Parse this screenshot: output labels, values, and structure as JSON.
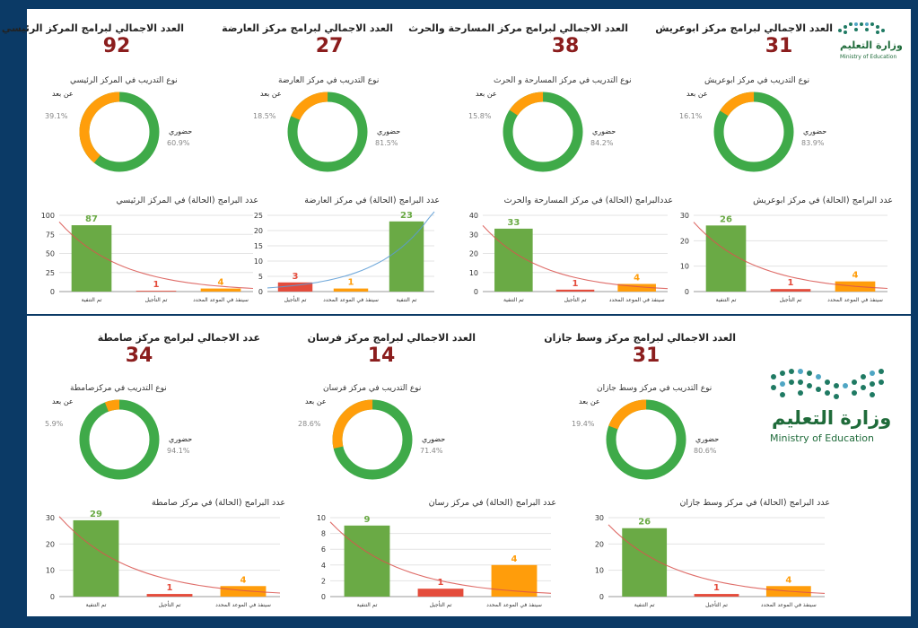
{
  "logo": {
    "arabic": "وزارة التعليم",
    "english": "Ministry of Education"
  },
  "labels": {
    "remote": "عن بعد",
    "inperson": "حضوري"
  },
  "centers": [
    {
      "title": "العدد الاجمالي لبرامج المركز الرئيسي",
      "total": "92",
      "donut_title": "نوع التدريب في المركز الرئيسي",
      "remote_pct": "39.1%",
      "inperson_pct": "60.9%",
      "bar_title": "عدد البرامج (الحالة) في المركز الرئيسي"
    },
    {
      "title": "العدد الاجمالي لبرامج مركز العارضة",
      "total": "27",
      "donut_title": "نوع التدريب في مركز العارضة",
      "remote_pct": "18.5%",
      "inperson_pct": "81.5%",
      "bar_title": "عدد البرامج (الحالة) في مركز العارضة"
    },
    {
      "title": "العدد الاجمالي لبرامج مركز المسارحة والحرث",
      "total": "38",
      "donut_title": "نوع التدريب في مركز المسارحة و الحرث",
      "remote_pct": "15.8%",
      "inperson_pct": "84.2%",
      "bar_title": "عددالبرامج (الحالة) في مركز المسارحة والحرث"
    },
    {
      "title": "العدد الاجمالي لبرامج مركز ابوعريش",
      "total": "31",
      "donut_title": "نوع التدريب في مركز ابوعريش",
      "remote_pct": "16.1%",
      "inperson_pct": "83.9%",
      "bar_title": "عدد البرامج (الحالة) في مركز ابوعريش"
    },
    {
      "title": "عدد الاجمالي لبرامج مركز صامطة",
      "total": "34",
      "donut_title": "نوع التدريب في مركزصامطة",
      "remote_pct": "5.9%",
      "inperson_pct": "94.1%",
      "bar_title": "عدد البرامج (الحالة) في مركز صامطة"
    },
    {
      "title": "العدد الاجمالي لبرامج مركز فرسان",
      "total": "14",
      "donut_title": "نوع التدريب في مركز فرسان",
      "remote_pct": "28.6%",
      "inperson_pct": "71.4%",
      "bar_title": "عدد البرامج (الحالة) في مركز رسان"
    },
    {
      "title": "العدد الاجمالي لبرامج مركز وسط جازان",
      "total": "31",
      "donut_title": "نوع التدريب في مركز وسط جازان",
      "remote_pct": "19.4%",
      "inperson_pct": "80.6%",
      "bar_title": "عدد البرامج (الحالة) في مركز وسط جازان"
    }
  ],
  "chart_data": [
    {
      "type": "pie",
      "title": "نوع التدريب في المركز الرئيسي",
      "categories": [
        "حضوري",
        "عن بعد"
      ],
      "values": [
        60.9,
        39.1
      ],
      "colors": [
        "#3faa49",
        "#ff9e0b"
      ]
    },
    {
      "type": "bar",
      "title": "عدد البرامج (الحالة) في المركز الرئيسي",
      "categories": [
        "تم التنفية",
        "تم التأجيل",
        "سينفذ في الموعد المحدد"
      ],
      "values": [
        87,
        1,
        4
      ],
      "ylim": [
        0,
        100
      ],
      "yticks": [
        0,
        25,
        50,
        75,
        100
      ],
      "colors": [
        "#6aaa45",
        "#e44c3c",
        "#ff9d0b"
      ],
      "trendline": "red"
    },
    {
      "type": "pie",
      "title": "نوع التدريب في مركز العارضة",
      "categories": [
        "حضوري",
        "عن بعد"
      ],
      "values": [
        81.5,
        18.5
      ],
      "colors": [
        "#3faa49",
        "#ff9e0b"
      ]
    },
    {
      "type": "bar",
      "title": "عدد البرامج (الحالة) في مركز العارضة",
      "categories": [
        "تم التأجيل",
        "سينفذ في الموعد المحدد",
        "تم التنفية"
      ],
      "values": [
        3,
        1,
        23
      ],
      "ylim": [
        0,
        25
      ],
      "yticks": [
        0,
        5,
        10,
        15,
        20,
        25
      ],
      "colors": [
        "#e44c3c",
        "#ff9d0b",
        "#6aaa45"
      ],
      "trendline": "blue"
    },
    {
      "type": "pie",
      "title": "نوع التدريب في مركز المسارحة و الحرث",
      "categories": [
        "حضوري",
        "عن بعد"
      ],
      "values": [
        84.2,
        15.8
      ],
      "colors": [
        "#3faa49",
        "#ff9e0b"
      ]
    },
    {
      "type": "bar",
      "title": "عددالبرامج (الحالة) في مركز المسارحة والحرث",
      "categories": [
        "تم التنفية",
        "تم التأجيل",
        "سينفذ في الموعد المحدد"
      ],
      "values": [
        33,
        1,
        4
      ],
      "ylim": [
        0,
        40
      ],
      "yticks": [
        0,
        10,
        20,
        30,
        40
      ],
      "colors": [
        "#6aaa45",
        "#e44c3c",
        "#ff9d0b"
      ],
      "trendline": "red"
    },
    {
      "type": "pie",
      "title": "نوع التدريب في مركز ابوعريش",
      "categories": [
        "حضوري",
        "عن بعد"
      ],
      "values": [
        83.9,
        16.1
      ],
      "colors": [
        "#3faa49",
        "#ff9e0b"
      ]
    },
    {
      "type": "bar",
      "title": "عدد البرامج (الحالة) في مركز ابوعريش",
      "categories": [
        "تم التنفية",
        "تم التأجيل",
        "سينفذ في الموعد المحدد"
      ],
      "values": [
        26,
        1,
        4
      ],
      "ylim": [
        0,
        30
      ],
      "yticks": [
        0,
        10,
        20,
        30
      ],
      "colors": [
        "#6aaa45",
        "#e44c3c",
        "#ff9d0b"
      ],
      "trendline": "red"
    },
    {
      "type": "pie",
      "title": "نوع التدريب في مركزصامطة",
      "categories": [
        "حضوري",
        "عن بعد"
      ],
      "values": [
        94.1,
        5.9
      ],
      "colors": [
        "#3faa49",
        "#ff9e0b"
      ]
    },
    {
      "type": "bar",
      "title": "عدد البرامج (الحالة) في مركز صامطة",
      "categories": [
        "تم التنفية",
        "تم التأجيل",
        "سينفذ في الموعد المحدد"
      ],
      "values": [
        29,
        1,
        4
      ],
      "ylim": [
        0,
        30
      ],
      "yticks": [
        0,
        10,
        20,
        30
      ],
      "colors": [
        "#6aaa45",
        "#e44c3c",
        "#ff9d0b"
      ],
      "trendline": "red"
    },
    {
      "type": "pie",
      "title": "نوع التدريب في مركز فرسان",
      "categories": [
        "حضوري",
        "عن بعد"
      ],
      "values": [
        71.4,
        28.6
      ],
      "colors": [
        "#3faa49",
        "#ff9e0b"
      ]
    },
    {
      "type": "bar",
      "title": "عدد البرامج (الحالة) في مركز رسان",
      "categories": [
        "تم التنفية",
        "تم التأجيل",
        "سينفذ في الموعد المحدد"
      ],
      "values": [
        9,
        1,
        4
      ],
      "ylim": [
        0,
        10
      ],
      "yticks": [
        0,
        2,
        4,
        6,
        8,
        10
      ],
      "colors": [
        "#6aaa45",
        "#e44c3c",
        "#ff9d0b"
      ],
      "trendline": "red"
    },
    {
      "type": "pie",
      "title": "نوع التدريب في مركز وسط جازان",
      "categories": [
        "حضوري",
        "عن بعد"
      ],
      "values": [
        80.6,
        19.4
      ],
      "colors": [
        "#3faa49",
        "#ff9e0b"
      ]
    },
    {
      "type": "bar",
      "title": "عدد البرامج (الحالة) في مركز وسط جازان",
      "categories": [
        "تم التنفية",
        "تم التأجيل",
        "سينفذ في الموعد المحدد"
      ],
      "values": [
        26,
        1,
        4
      ],
      "ylim": [
        0,
        30
      ],
      "yticks": [
        0,
        10,
        20,
        30
      ],
      "colors": [
        "#6aaa45",
        "#e44c3c",
        "#ff9d0b"
      ],
      "trendline": "red"
    }
  ]
}
